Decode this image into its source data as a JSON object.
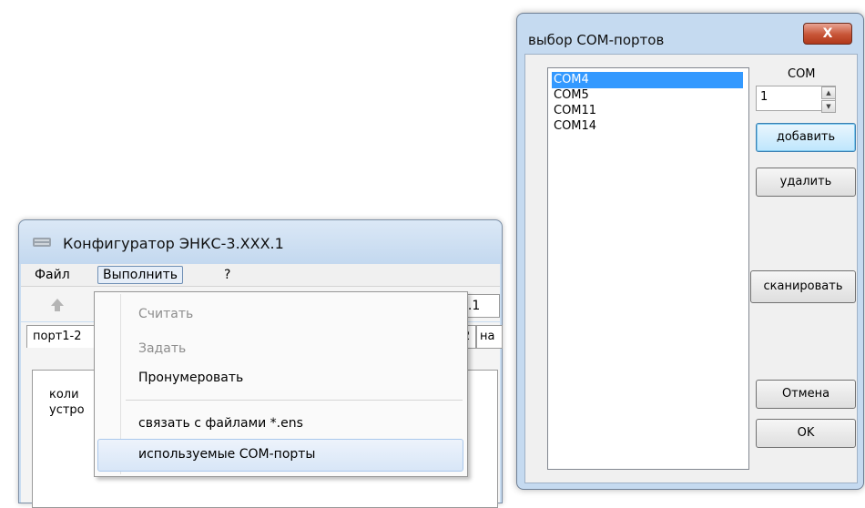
{
  "main_window": {
    "title": "Конфигуратор ЭНКС-3.XXX.1",
    "menu": {
      "file": "Файл",
      "run": "Выполнить",
      "help": "?"
    },
    "toolbar": {
      "field_fragment": "0.1"
    },
    "tabs": {
      "left": "порт1-2",
      "right_a": "2",
      "right_b": "на"
    },
    "panel": {
      "line1": "коли",
      "line2": "устро"
    }
  },
  "run_menu": {
    "items": [
      {
        "label": "Считать",
        "enabled": false
      },
      {
        "label": "Задать",
        "enabled": false
      },
      {
        "label": "Пронумеровать",
        "enabled": true
      },
      {
        "label": "связать с файлами *.ens",
        "enabled": true
      },
      {
        "label": "используемые COM-порты",
        "enabled": true,
        "highlighted": true
      }
    ]
  },
  "com_dialog": {
    "title": "выбор COM-портов",
    "close_glyph": "X",
    "ports": [
      "COM4",
      "COM5",
      "COM11",
      "COM14"
    ],
    "selected_port": "COM4",
    "com_label": "COM",
    "com_value": "1",
    "buttons": {
      "add": "добавить",
      "remove": "удалить",
      "scan": "сканировать",
      "cancel": "Отмена",
      "ok": "OK"
    }
  },
  "colors": {
    "selection": "#3399ff",
    "window_frame": "#c5daf0",
    "menu_highlight": "#d8e6f7"
  }
}
